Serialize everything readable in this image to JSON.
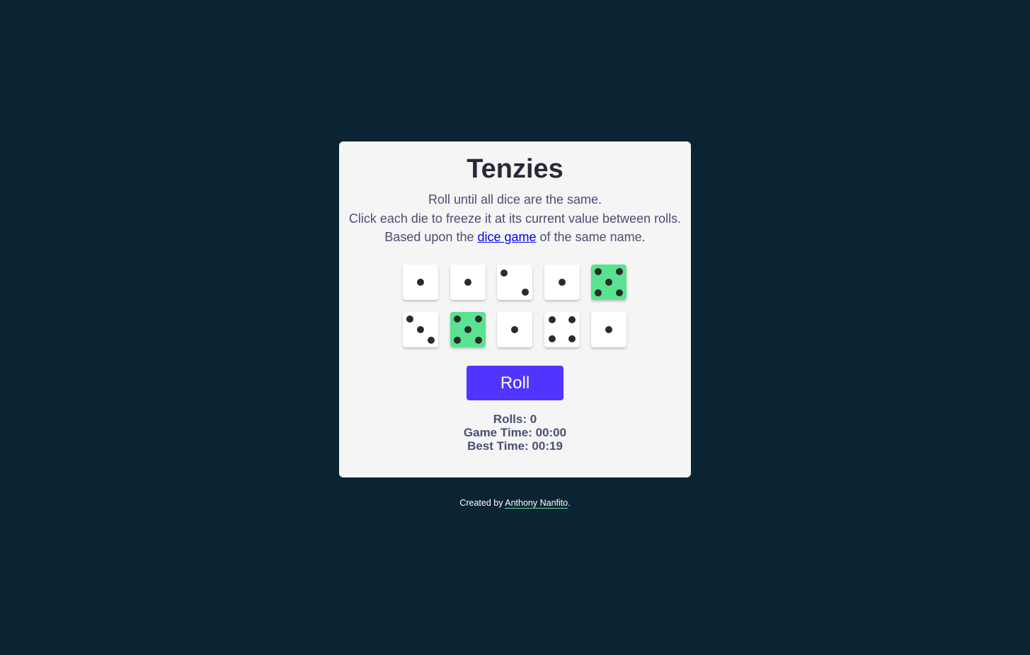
{
  "game": {
    "title": "Tenzies",
    "instructions": {
      "line1": "Roll until all dice are the same.",
      "line2": "Click each die to freeze it at its current value between rolls.",
      "line3_before": "Based upon the ",
      "line3_link": "dice game",
      "line3_after": " of the same name."
    },
    "dice": [
      {
        "value": 1,
        "held": false
      },
      {
        "value": 1,
        "held": false
      },
      {
        "value": 2,
        "held": false
      },
      {
        "value": 1,
        "held": false
      },
      {
        "value": 5,
        "held": true
      },
      {
        "value": 3,
        "held": false
      },
      {
        "value": 5,
        "held": true
      },
      {
        "value": 1,
        "held": false
      },
      {
        "value": 4,
        "held": false
      },
      {
        "value": 1,
        "held": false
      }
    ],
    "roll_button_label": "Roll",
    "stats": {
      "rolls": "Rolls: 0",
      "game_time": "Game Time: 00:00",
      "best_time": "Best Time: 00:19"
    }
  },
  "footer": {
    "prefix": "Created by ",
    "author_link": "Anthony Nanfito",
    "suffix": "."
  },
  "colors": {
    "background": "#0b2434",
    "card": "#f5f5f5",
    "held_die": "#59e391",
    "roll_button": "#5035ff",
    "text": "#4a4e74"
  }
}
